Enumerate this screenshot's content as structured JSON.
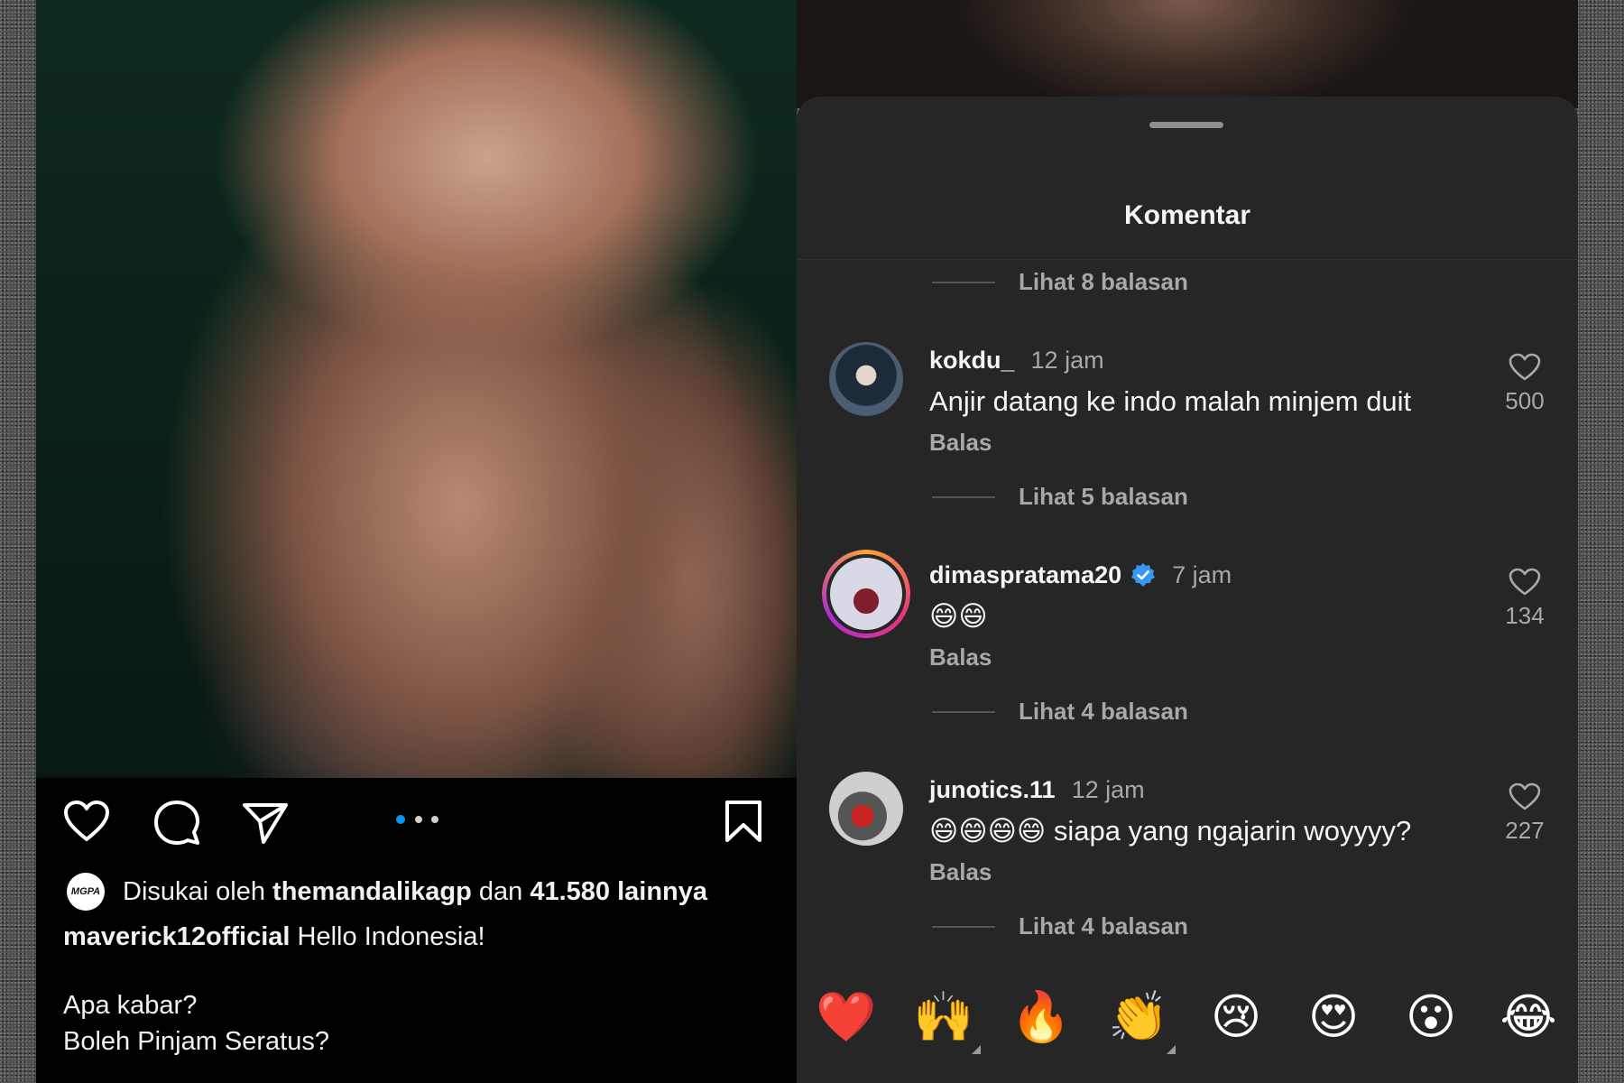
{
  "post": {
    "liked_by_prefix": "Disukai oleh",
    "liked_by_user": "themandalikagp",
    "liked_by_and": "dan",
    "liked_by_others": "41.580 lainnya",
    "liker_avatar_text": "MGPA",
    "caption_user": "maverick12official",
    "caption_text": "Hello Indonesia!",
    "caption_line2": "Apa kabar?",
    "caption_line3": "Boleh Pinjam Seratus?"
  },
  "sheet": {
    "title": "Komentar"
  },
  "comments": [
    {
      "user": "kokdu_",
      "time": "12 jam",
      "text": "Anjir datang ke indo malah minjem duit",
      "reply_label": "Balas",
      "likes": "500",
      "verified": false
    },
    {
      "user": "dimaspratama20",
      "time": "7 jam",
      "text": "😄😄",
      "reply_label": "Balas",
      "likes": "134",
      "verified": true
    },
    {
      "user": "junotics.11",
      "time": "12 jam",
      "text": "😄😄😄😄 siapa yang ngajarin woyyyy?",
      "reply_label": "Balas",
      "likes": "227",
      "verified": false
    }
  ],
  "view_replies": [
    "Lihat 8 balasan",
    "Lihat 5 balasan",
    "Lihat 4 balasan",
    "Lihat 4 balasan"
  ],
  "emoji_reactions": [
    "❤️",
    "🙌",
    "🔥",
    "👏",
    "😢",
    "😍",
    "😮",
    "😂"
  ],
  "colors": {
    "sheet_bg": "#262626",
    "verified_blue": "#3897f0",
    "dot_active": "#0095f6"
  }
}
